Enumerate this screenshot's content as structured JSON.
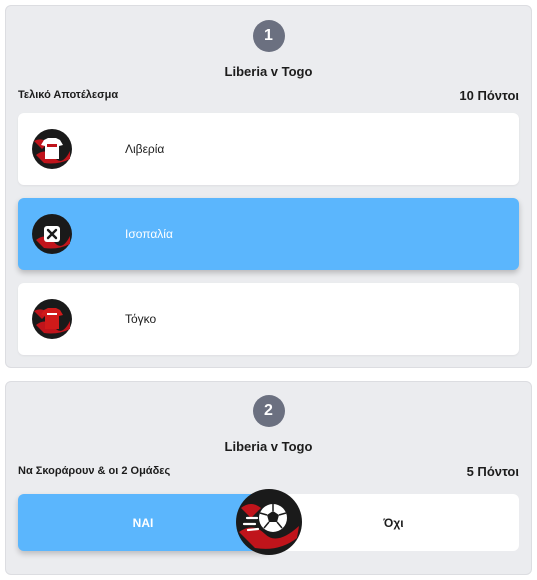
{
  "questions": [
    {
      "number": "1",
      "match": "Liberia v Togo",
      "market": "Τελικό Αποτέλεσμα",
      "points": "10 Πόντοι",
      "options": [
        {
          "label": "Λιβερία",
          "icon": "liberia-shirt-icon",
          "selected": false
        },
        {
          "label": "Ισοπαλία",
          "icon": "draw-x-icon",
          "selected": true
        },
        {
          "label": "Τόγκο",
          "icon": "togo-shirt-icon",
          "selected": false
        }
      ]
    },
    {
      "number": "2",
      "match": "Liberia v Togo",
      "market": "Να Σκοράρουν & οι 2 Ομάδες",
      "points": "5 Πόντοι",
      "yes_label": "ΝΑΙ",
      "no_label": "Όχι",
      "selected": "yes",
      "badge_icon": "soccer-ball-icon"
    }
  ],
  "colors": {
    "accent": "#5bb6fd",
    "badge": "#6b7080",
    "card": "#ebecef"
  }
}
